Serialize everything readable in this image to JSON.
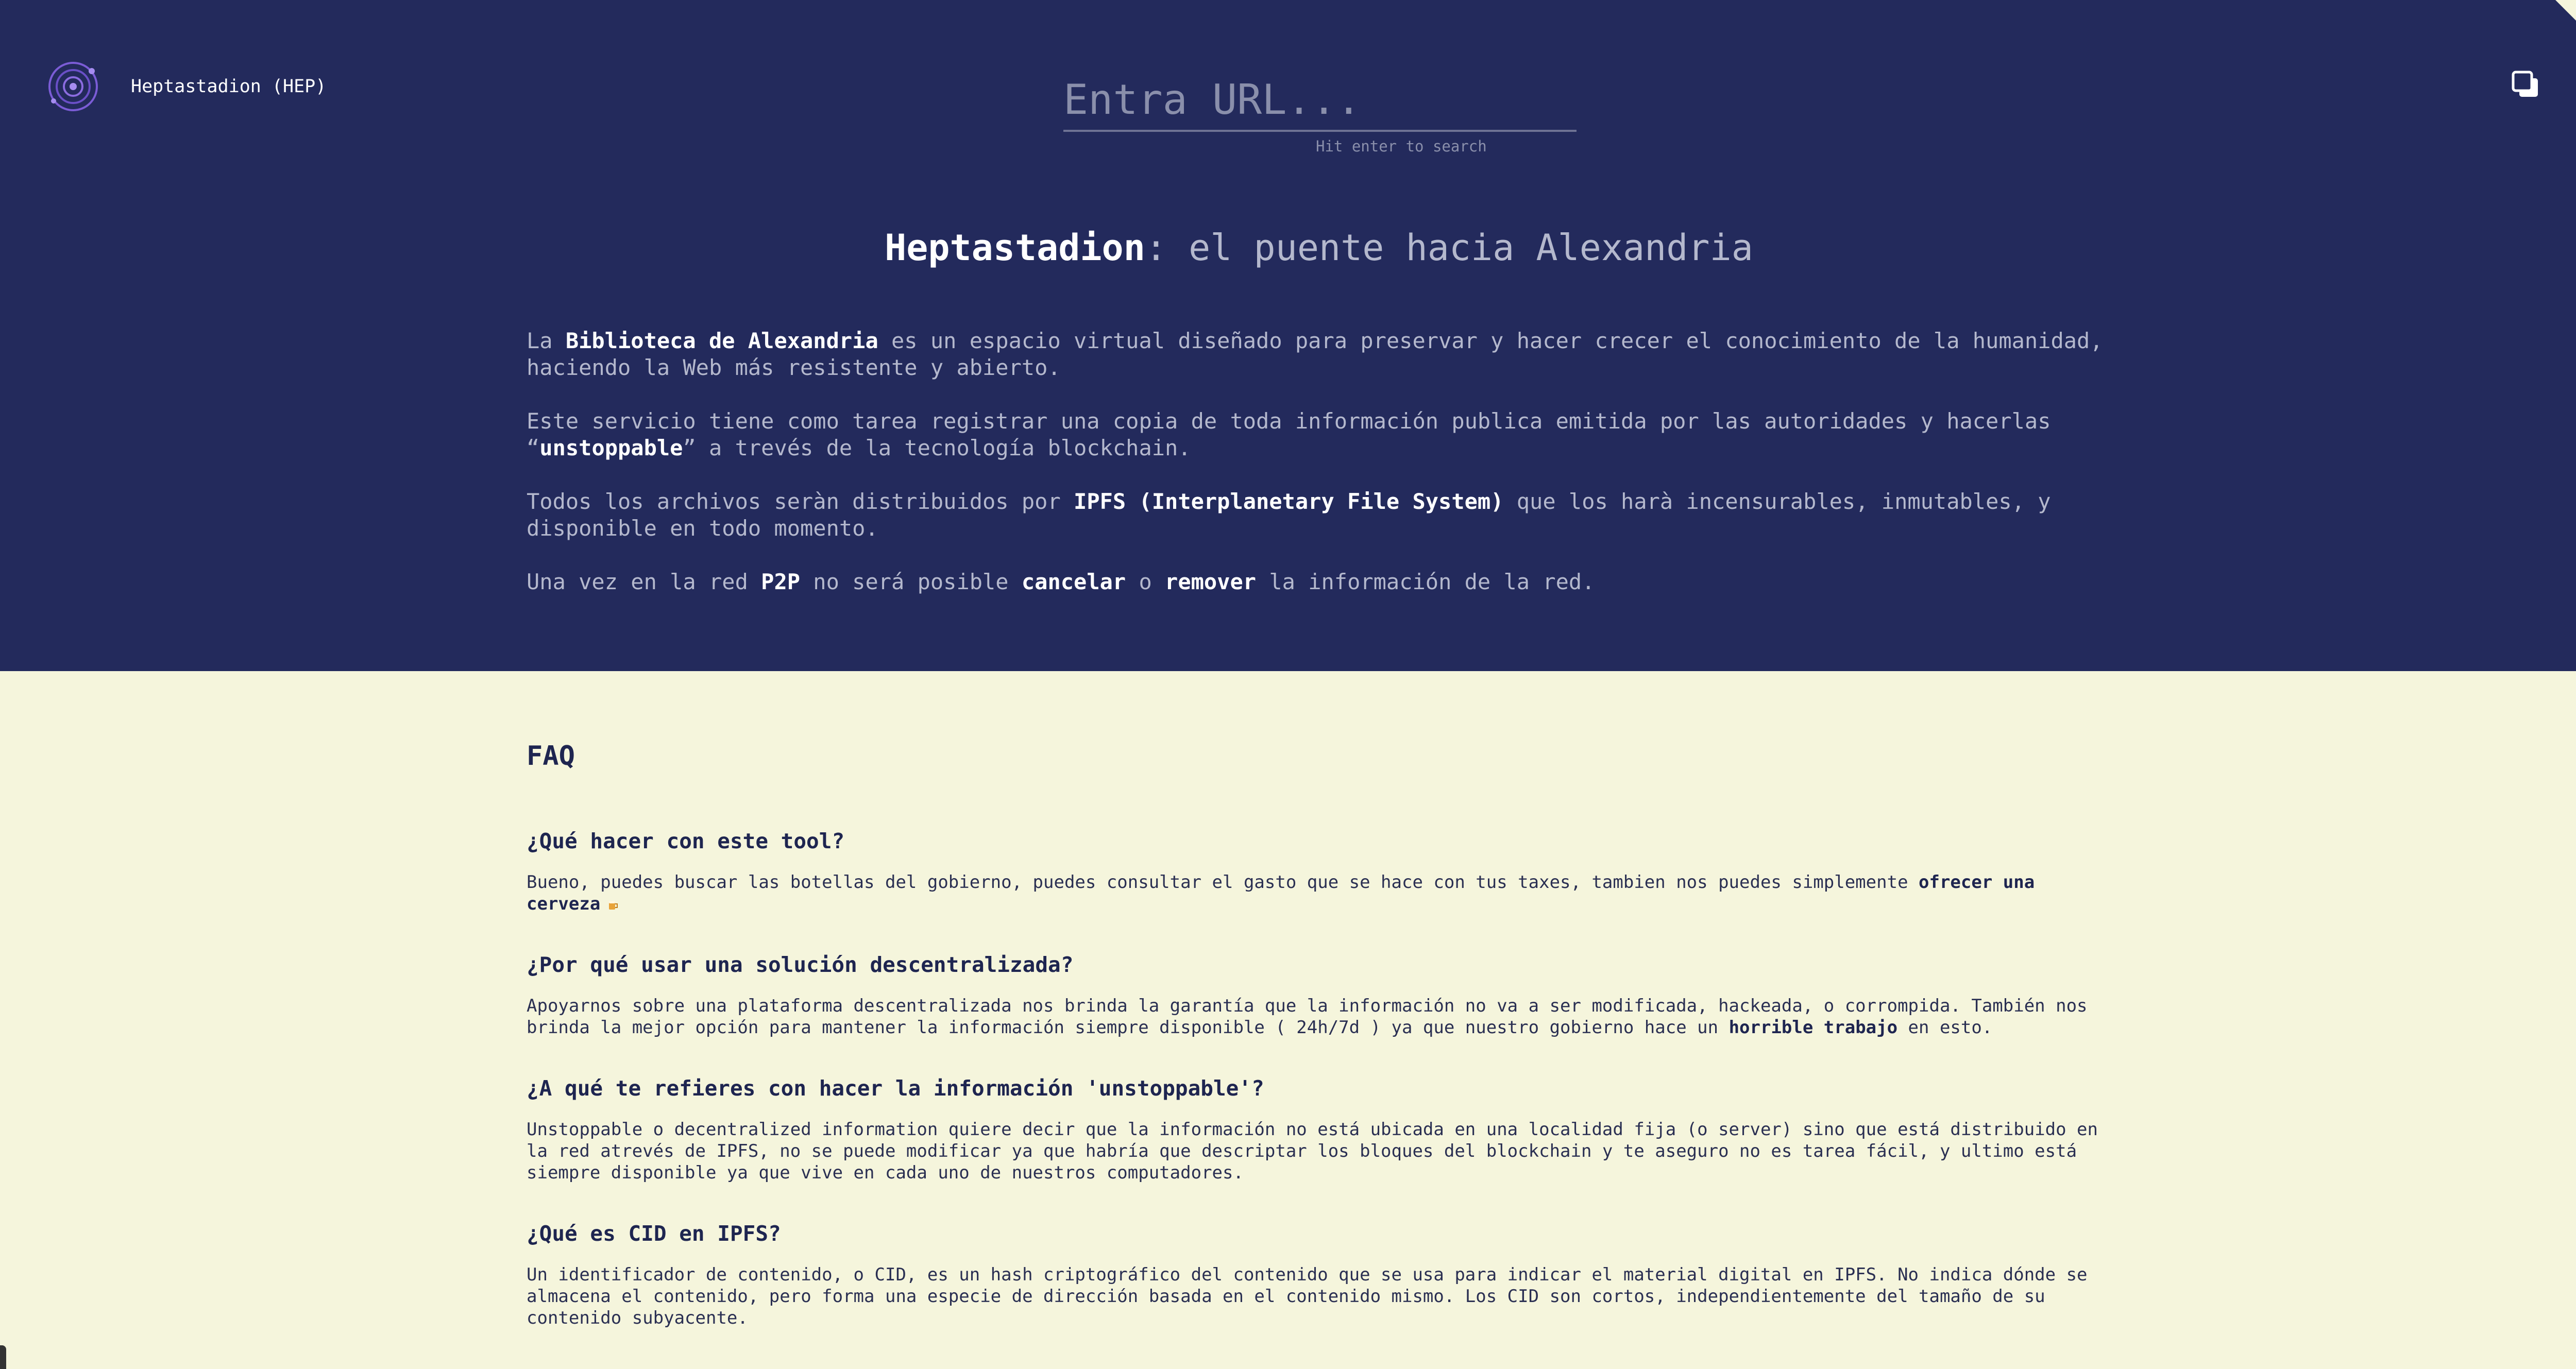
{
  "header": {
    "brand": "Heptastadion (HEP)",
    "search_placeholder": "Entra URL...",
    "search_value": "",
    "search_hint": "Hit enter to search"
  },
  "hero": {
    "title_strong": "Heptastadion",
    "title_rest": ": el puente hacia Alexandria",
    "p1": {
      "t1": "La ",
      "b1": "Biblioteca de Alexandria",
      "t2": " es un espacio virtual diseñado para preservar y hacer crecer el conocimiento de la humanidad, haciendo la Web más resistente y abierto."
    },
    "p2": {
      "t1": "Este servicio tiene como tarea registrar una copia de toda información publica emitida por las autoridades y hacerlas “",
      "b1": "unstoppable",
      "t2": "” a trevés de la tecnología blockchain."
    },
    "p3": {
      "t1": "Todos los archivos seràn distribuidos por ",
      "b1": "IPFS (Interplanetary File System)",
      "t2": " que los harà incensurables, inmutables, y disponible en todo momento."
    },
    "p4": {
      "t1": "Una vez en la red ",
      "b1": "P2P",
      "t2": " no será posible ",
      "b2": "cancelar",
      "t3": " o ",
      "b3": "remover",
      "t4": " la información de la red."
    }
  },
  "faq": {
    "title": "FAQ",
    "items": [
      {
        "q": "¿Qué hacer con este tool?",
        "a1": "Bueno, puedes buscar las botellas del gobierno, puedes consultar el gasto que se hace con tus taxes, tambien nos puedes simplemente ",
        "link": "ofrecer una cerveza",
        "a2": ""
      },
      {
        "q": "¿Por qué usar una solución descentralizada?",
        "a1": "Apoyarnos sobre una plataforma descentralizada nos brinda la garantía que la información no va a ser modificada, hackeada, o corrompida. También nos brinda la mejor opción para mantener la información siempre disponible ( 24h/7d ) ya que nuestro gobierno hace un ",
        "link": "horrible trabajo",
        "a2": " en esto."
      },
      {
        "q": "¿A qué te refieres con hacer la información 'unstoppable'?",
        "a1": "Unstoppable o decentralized information quiere decir que la información no está ubicada en una localidad fija (o server) sino que está distribuido en la red atrevés de IPFS, no se puede modificar ya que habría que descriptar los bloques del blockchain y te aseguro no es tarea fácil, y ultimo está siempre disponible ya que vive en cada uno de nuestros computadores.",
        "link": "",
        "a2": ""
      },
      {
        "q": "¿Qué es CID en IPFS?",
        "a1": "Un identificador de contenido, o CID, es un hash criptográfico del contenido que se usa para indicar el material digital en IPFS. No indica dónde se almacena el contenido, pero forma una especie de dirección basada en el contenido mismo. Los CID son cortos, independientemente del tamaño de su contenido subyacente.",
        "link": "",
        "a2": ""
      }
    ]
  },
  "icons": {
    "logo": "atom-logo-icon",
    "copy": "copy-icon",
    "corner": "github-corner-icon",
    "beer": "beer-icon"
  },
  "colors": {
    "hero_bg": "#232a5c",
    "page_bg": "#f5f5dc",
    "accent": "#7b5cd6"
  }
}
